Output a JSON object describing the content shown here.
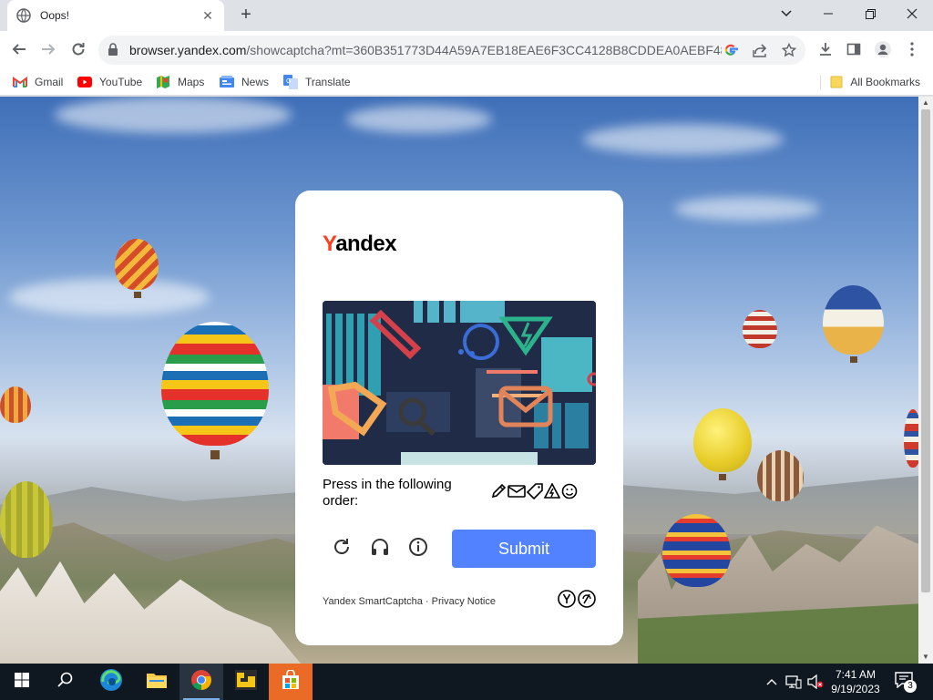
{
  "browser": {
    "tab": {
      "title": "Oops!"
    },
    "url": {
      "host": "browser.yandex.com",
      "path": "/showcaptcha?mt=360B351773D44A59A7EB18EAE6F3CC4128B8CDDEA0AEBF481..."
    },
    "bookmarks": [
      {
        "label": "Gmail",
        "icon": "gmail-icon"
      },
      {
        "label": "YouTube",
        "icon": "youtube-icon"
      },
      {
        "label": "Maps",
        "icon": "maps-icon"
      },
      {
        "label": "News",
        "icon": "news-icon"
      },
      {
        "label": "Translate",
        "icon": "translate-icon"
      }
    ],
    "all_bookmarks": "All Bookmarks"
  },
  "captcha": {
    "logo_first": "Y",
    "logo_rest": "andex",
    "instruction": "Press in the following order:",
    "order_icons": [
      "pencil-icon",
      "envelope-icon",
      "tag-icon",
      "lightning-shield-icon",
      "smiley-icon"
    ],
    "submit_label": "Submit",
    "footer_brand": "Yandex SmartCaptcha",
    "footer_sep": " · ",
    "footer_privacy": "Privacy Notice",
    "brand_color": "#fc3f1d",
    "button_color": "#5282ff"
  },
  "taskbar": {
    "time": "7:41 AM",
    "date": "9/19/2023",
    "notification_count": "3"
  }
}
